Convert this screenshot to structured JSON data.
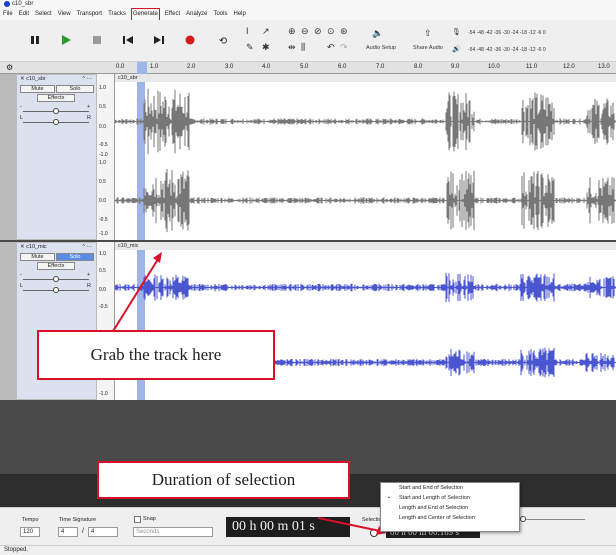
{
  "app": {
    "title": "c10_sbr"
  },
  "menu": [
    "File",
    "Edit",
    "Select",
    "View",
    "Transport",
    "Tracks",
    "Generate",
    "Effect",
    "Analyze",
    "Tools",
    "Help"
  ],
  "toolbar": {
    "audio_setup": "Audio Setup",
    "share_audio": "Share Audio",
    "meter_ticks": [
      "-54",
      "-48",
      "-42",
      "-36",
      "-30",
      "-24",
      "-18",
      "-12",
      "-6",
      "0"
    ]
  },
  "ruler": {
    "ticks": [
      "0.0",
      "1.0",
      "2.0",
      "3.0",
      "4.0",
      "5.0",
      "6.0",
      "7.0",
      "8.0",
      "9.0",
      "10.0",
      "11.0",
      "12.0",
      "13.0"
    ]
  },
  "tracks": [
    {
      "name": "c10_sbr",
      "clip": "c10_sbr",
      "mute": "Mute",
      "solo": "Solo",
      "effects": "Effects",
      "solo_on": false,
      "wave_color": "#777777"
    },
    {
      "name": "c10_mic",
      "clip": "c10_mic",
      "mute": "Mute",
      "solo": "Solo",
      "effects": "Effects",
      "solo_on": true,
      "wave_color": "#4a55d0"
    }
  ],
  "scale_labels": [
    "1.0",
    "0.5",
    "0.0",
    "-0.5",
    "-1.0"
  ],
  "pan_labels": {
    "left": "L",
    "right": "R",
    "minus": "-",
    "plus": "+"
  },
  "callouts": {
    "grab": "Grab the track here",
    "duration": "Duration of selection"
  },
  "bottom": {
    "tempo_label": "Tempo",
    "tempo_value": "120",
    "sig_label": "Time Signature",
    "sig_num": "4",
    "sig_den": "4",
    "snap_label": "Snap",
    "snap_unit": "Seconds",
    "time": "00 h 00 m 01 s",
    "selection_label": "Selection",
    "selection_time": "00 h 00 m 00.189 s"
  },
  "popup": {
    "items": [
      "Start and End of Selection",
      "Start and Length of Selection",
      "Length and End of Selection",
      "Length and Center of Selection"
    ],
    "selected_index": 1
  },
  "status": "Stopped.",
  "colors": {
    "accent": "#d9102a",
    "selection": "#9fb4e8"
  }
}
